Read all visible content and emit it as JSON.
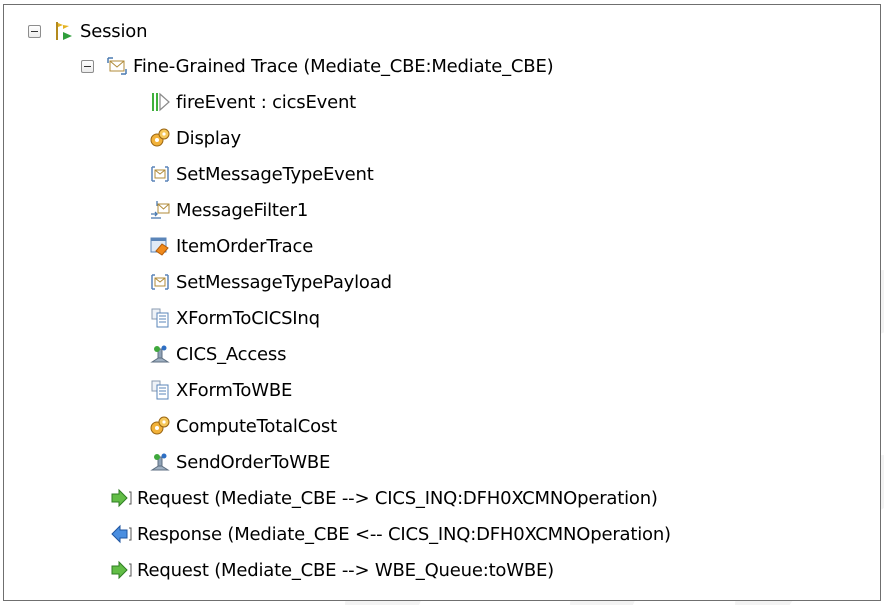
{
  "tree": {
    "session": {
      "label": "Session",
      "icon": "session-icon"
    },
    "trace": {
      "label": "Fine-Grained Trace (Mediate_CBE:Mediate_CBE)",
      "icon": "trace-envelope-icon"
    },
    "nodes": [
      {
        "label": "fireEvent : cicsEvent",
        "icon": "event-play-icon"
      },
      {
        "label": "Display",
        "icon": "gears-icon"
      },
      {
        "label": "SetMessageTypeEvent",
        "icon": "message-type-icon"
      },
      {
        "label": "MessageFilter1",
        "icon": "message-filter-icon"
      },
      {
        "label": "ItemOrderTrace",
        "icon": "trace-node-icon"
      },
      {
        "label": "SetMessageTypePayload",
        "icon": "message-type-icon"
      },
      {
        "label": "XFormToCICSInq",
        "icon": "xform-document-icon"
      },
      {
        "label": "CICS_Access",
        "icon": "service-invoke-icon"
      },
      {
        "label": "XFormToWBE",
        "icon": "xform-document-icon"
      },
      {
        "label": "ComputeTotalCost",
        "icon": "gears-icon"
      },
      {
        "label": "SendOrderToWBE",
        "icon": "service-invoke-icon"
      }
    ],
    "operations": [
      {
        "label": "Request (Mediate_CBE --> CICS_INQ:DFH0XCMNOperation)",
        "icon": "request-arrow-icon"
      },
      {
        "label": "Response (Mediate_CBE <-- CICS_INQ:DFH0XCMNOperation)",
        "icon": "response-arrow-icon"
      },
      {
        "label": "Request (Mediate_CBE --> WBE_Queue:toWBE)",
        "icon": "request-arrow-icon"
      }
    ]
  },
  "colors": {
    "border": "#6f6f6f",
    "request": "#55b33a",
    "response": "#3d7fd3",
    "gear": "#c98a1b"
  }
}
